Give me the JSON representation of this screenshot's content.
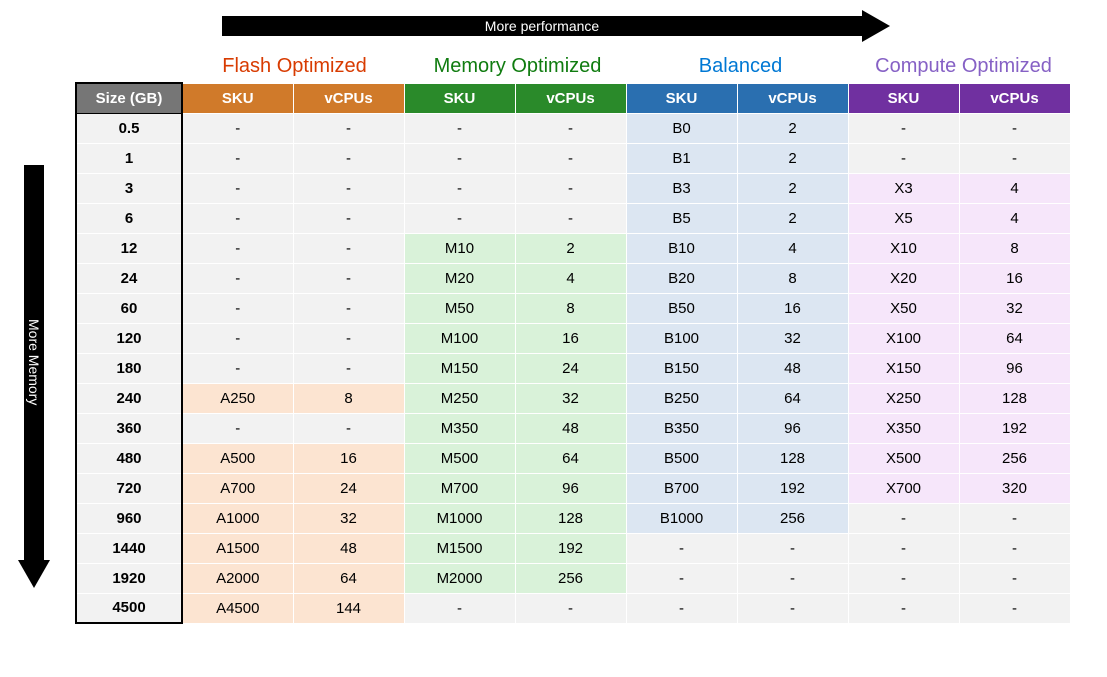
{
  "axes": {
    "top_label": "More performance",
    "left_label": "More Memory"
  },
  "groups": [
    {
      "key": "flash",
      "label": "Flash Optimized",
      "header_class": "h-flash",
      "tint_class": "tint-flash",
      "label_class": "gl-flash"
    },
    {
      "key": "mem",
      "label": "Memory Optimized",
      "header_class": "h-mem",
      "tint_class": "tint-mem",
      "label_class": "gl-mem"
    },
    {
      "key": "bal",
      "label": "Balanced",
      "header_class": "h-bal",
      "tint_class": "tint-bal",
      "label_class": "gl-bal"
    },
    {
      "key": "comp",
      "label": "Compute Optimized",
      "header_class": "h-comp",
      "tint_class": "tint-comp",
      "label_class": "gl-comp"
    }
  ],
  "columns": {
    "size_header": "Size (GB)",
    "sku_header": "SKU",
    "vcpu_header": "vCPUs"
  },
  "chart_data": {
    "type": "table",
    "size_column": "Size (GB)",
    "tiers": [
      "Flash Optimized",
      "Memory Optimized",
      "Balanced",
      "Compute Optimized"
    ],
    "subcolumns": [
      "SKU",
      "vCPUs"
    ],
    "rows": [
      {
        "size": "0.5",
        "flash": {
          "sku": null,
          "vcpu": null
        },
        "mem": {
          "sku": null,
          "vcpu": null
        },
        "bal": {
          "sku": "B0",
          "vcpu": 2
        },
        "comp": {
          "sku": null,
          "vcpu": null
        }
      },
      {
        "size": "1",
        "flash": {
          "sku": null,
          "vcpu": null
        },
        "mem": {
          "sku": null,
          "vcpu": null
        },
        "bal": {
          "sku": "B1",
          "vcpu": 2
        },
        "comp": {
          "sku": null,
          "vcpu": null
        }
      },
      {
        "size": "3",
        "flash": {
          "sku": null,
          "vcpu": null
        },
        "mem": {
          "sku": null,
          "vcpu": null
        },
        "bal": {
          "sku": "B3",
          "vcpu": 2
        },
        "comp": {
          "sku": "X3",
          "vcpu": 4
        }
      },
      {
        "size": "6",
        "flash": {
          "sku": null,
          "vcpu": null
        },
        "mem": {
          "sku": null,
          "vcpu": null
        },
        "bal": {
          "sku": "B5",
          "vcpu": 2
        },
        "comp": {
          "sku": "X5",
          "vcpu": 4
        }
      },
      {
        "size": "12",
        "flash": {
          "sku": null,
          "vcpu": null
        },
        "mem": {
          "sku": "M10",
          "vcpu": 2
        },
        "bal": {
          "sku": "B10",
          "vcpu": 4
        },
        "comp": {
          "sku": "X10",
          "vcpu": 8
        }
      },
      {
        "size": "24",
        "flash": {
          "sku": null,
          "vcpu": null
        },
        "mem": {
          "sku": "M20",
          "vcpu": 4
        },
        "bal": {
          "sku": "B20",
          "vcpu": 8
        },
        "comp": {
          "sku": "X20",
          "vcpu": 16
        }
      },
      {
        "size": "60",
        "flash": {
          "sku": null,
          "vcpu": null
        },
        "mem": {
          "sku": "M50",
          "vcpu": 8
        },
        "bal": {
          "sku": "B50",
          "vcpu": 16
        },
        "comp": {
          "sku": "X50",
          "vcpu": 32
        }
      },
      {
        "size": "120",
        "flash": {
          "sku": null,
          "vcpu": null
        },
        "mem": {
          "sku": "M100",
          "vcpu": 16
        },
        "bal": {
          "sku": "B100",
          "vcpu": 32
        },
        "comp": {
          "sku": "X100",
          "vcpu": 64
        }
      },
      {
        "size": "180",
        "flash": {
          "sku": null,
          "vcpu": null
        },
        "mem": {
          "sku": "M150",
          "vcpu": 24
        },
        "bal": {
          "sku": "B150",
          "vcpu": 48
        },
        "comp": {
          "sku": "X150",
          "vcpu": 96
        }
      },
      {
        "size": "240",
        "flash": {
          "sku": "A250",
          "vcpu": 8
        },
        "mem": {
          "sku": "M250",
          "vcpu": 32
        },
        "bal": {
          "sku": "B250",
          "vcpu": 64
        },
        "comp": {
          "sku": "X250",
          "vcpu": 128
        }
      },
      {
        "size": "360",
        "flash": {
          "sku": null,
          "vcpu": null
        },
        "mem": {
          "sku": "M350",
          "vcpu": 48
        },
        "bal": {
          "sku": "B350",
          "vcpu": 96
        },
        "comp": {
          "sku": "X350",
          "vcpu": 192
        }
      },
      {
        "size": "480",
        "flash": {
          "sku": "A500",
          "vcpu": 16
        },
        "mem": {
          "sku": "M500",
          "vcpu": 64
        },
        "bal": {
          "sku": "B500",
          "vcpu": 128
        },
        "comp": {
          "sku": "X500",
          "vcpu": 256
        }
      },
      {
        "size": "720",
        "flash": {
          "sku": "A700",
          "vcpu": 24
        },
        "mem": {
          "sku": "M700",
          "vcpu": 96
        },
        "bal": {
          "sku": "B700",
          "vcpu": 192
        },
        "comp": {
          "sku": "X700",
          "vcpu": 320
        }
      },
      {
        "size": "960",
        "flash": {
          "sku": "A1000",
          "vcpu": 32
        },
        "mem": {
          "sku": "M1000",
          "vcpu": 128
        },
        "bal": {
          "sku": "B1000",
          "vcpu": 256
        },
        "comp": {
          "sku": null,
          "vcpu": null
        }
      },
      {
        "size": "1440",
        "flash": {
          "sku": "A1500",
          "vcpu": 48
        },
        "mem": {
          "sku": "M1500",
          "vcpu": 192
        },
        "bal": {
          "sku": null,
          "vcpu": null
        },
        "comp": {
          "sku": null,
          "vcpu": null
        }
      },
      {
        "size": "1920",
        "flash": {
          "sku": "A2000",
          "vcpu": 64
        },
        "mem": {
          "sku": "M2000",
          "vcpu": 256
        },
        "bal": {
          "sku": null,
          "vcpu": null
        },
        "comp": {
          "sku": null,
          "vcpu": null
        }
      },
      {
        "size": "4500",
        "flash": {
          "sku": "A4500",
          "vcpu": 144
        },
        "mem": {
          "sku": null,
          "vcpu": null
        },
        "bal": {
          "sku": null,
          "vcpu": null
        },
        "comp": {
          "sku": null,
          "vcpu": null
        }
      }
    ]
  }
}
